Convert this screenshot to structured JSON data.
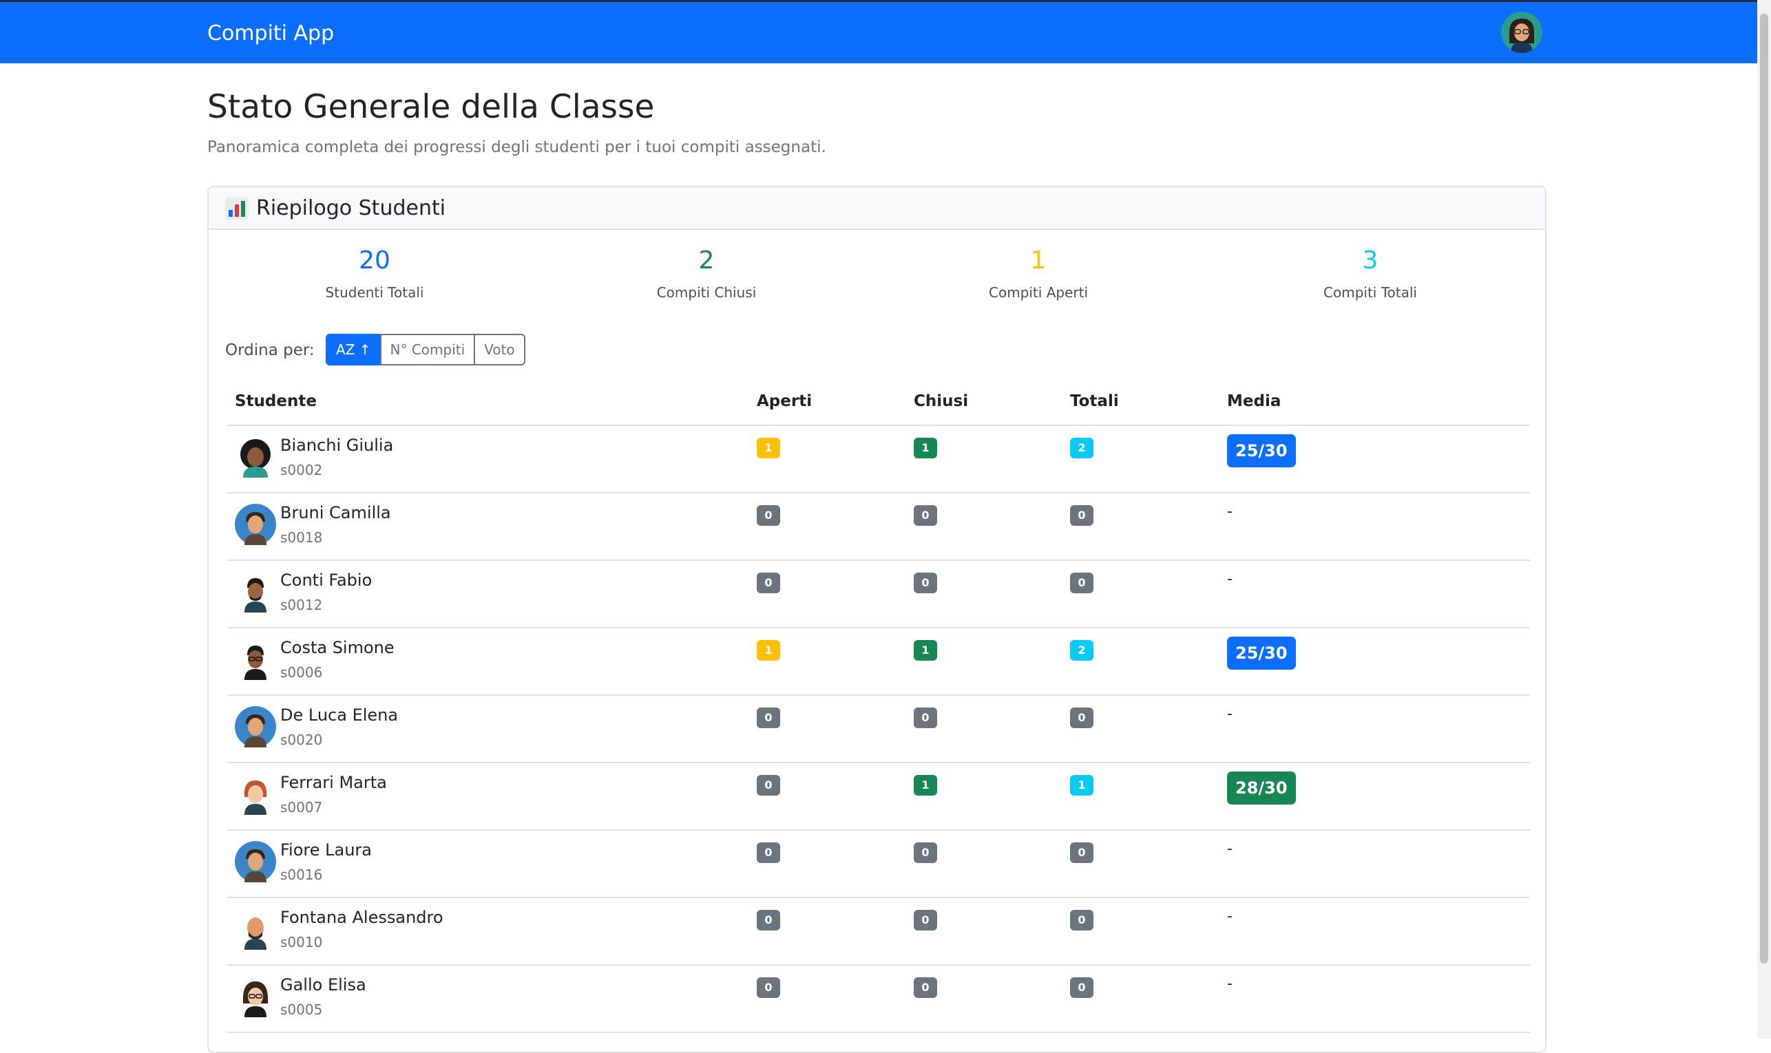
{
  "navbar": {
    "brand": "Compiti App",
    "avatar_icon": "user-avatar-icon"
  },
  "page": {
    "title": "Stato Generale della Classe",
    "subtitle": "Panoramica completa dei progressi degli studenti per i tuoi compiti assegnati."
  },
  "summary": {
    "header_icon": "bar-chart-icon",
    "title": "Riepilogo Studenti",
    "stats": [
      {
        "value": "20",
        "label": "Studenti Totali",
        "color": "#0d6efd"
      },
      {
        "value": "2",
        "label": "Compiti Chiusi",
        "color": "#198754"
      },
      {
        "value": "1",
        "label": "Compiti Aperti",
        "color": "#ffc107"
      },
      {
        "value": "3",
        "label": "Compiti Totali",
        "color": "#0dcaf0"
      }
    ]
  },
  "sort": {
    "label": "Ordina per:",
    "options": [
      "AZ ↑",
      "N° Compiti",
      "Voto"
    ],
    "active": "AZ ↑"
  },
  "table": {
    "headers": {
      "student": "Studente",
      "open": "Aperti",
      "closed": "Chiusi",
      "total": "Totali",
      "average": "Media"
    },
    "rows": [
      {
        "name": "Bianchi Giulia",
        "code": "s0002",
        "open": "1",
        "closed": "1",
        "total": "2",
        "average": "25/30"
      },
      {
        "name": "Bruni Camilla",
        "code": "s0018",
        "open": "0",
        "closed": "0",
        "total": "0",
        "average": "-"
      },
      {
        "name": "Conti Fabio",
        "code": "s0012",
        "open": "0",
        "closed": "0",
        "total": "0",
        "average": "-"
      },
      {
        "name": "Costa Simone",
        "code": "s0006",
        "open": "1",
        "closed": "1",
        "total": "2",
        "average": "25/30"
      },
      {
        "name": "De Luca Elena",
        "code": "s0020",
        "open": "0",
        "closed": "0",
        "total": "0",
        "average": "-"
      },
      {
        "name": "Ferrari Marta",
        "code": "s0007",
        "open": "0",
        "closed": "1",
        "total": "1",
        "average": "28/30"
      },
      {
        "name": "Fiore Laura",
        "code": "s0016",
        "open": "0",
        "closed": "0",
        "total": "0",
        "average": "-"
      },
      {
        "name": "Fontana Alessandro",
        "code": "s0010",
        "open": "0",
        "closed": "0",
        "total": "0",
        "average": "-"
      },
      {
        "name": "Gallo Elisa",
        "code": "s0005",
        "open": "0",
        "closed": "0",
        "total": "0",
        "average": "-"
      }
    ]
  },
  "colors": {
    "primary": "#0d6efd",
    "success": "#198754",
    "warning": "#ffc107",
    "info": "#0dcaf0",
    "secondary": "#6c757d"
  }
}
